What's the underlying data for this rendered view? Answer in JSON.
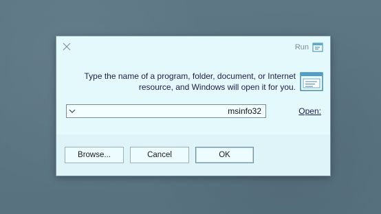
{
  "window": {
    "title": "Run",
    "close_icon": "close-icon",
    "title_icon": "run-icon"
  },
  "body": {
    "icon": "run-icon",
    "description_line1": "Type the name of a program, folder, document, or Internet",
    "description_line2": "resource, and Windows will open it for you."
  },
  "open": {
    "label": "Open:",
    "value": "msinfo32",
    "dropdown_icon": "chevron-down-icon"
  },
  "buttons": {
    "ok": "OK",
    "cancel": "Cancel",
    "browse": "Browse..."
  }
}
